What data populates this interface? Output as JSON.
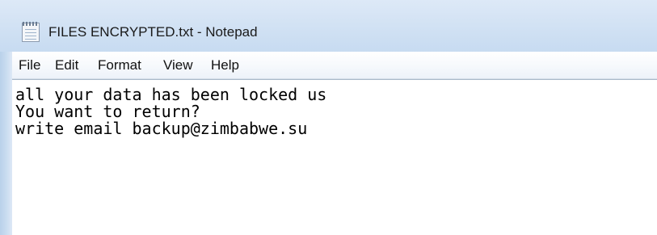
{
  "window": {
    "title": "FILES ENCRYPTED.txt - Notepad",
    "icon": "notepad-icon"
  },
  "menu": {
    "items": [
      "File",
      "Edit",
      "Format",
      "View",
      "Help"
    ]
  },
  "editor": {
    "lines": [
      "all your data has been locked us",
      "You want to return?",
      "write email backup@zimbabwe.su"
    ]
  },
  "colors": {
    "titlebar": "#cfe0f3",
    "menubar": "#f5f8fc",
    "editor_background": "#ffffff",
    "text": "#000000"
  }
}
